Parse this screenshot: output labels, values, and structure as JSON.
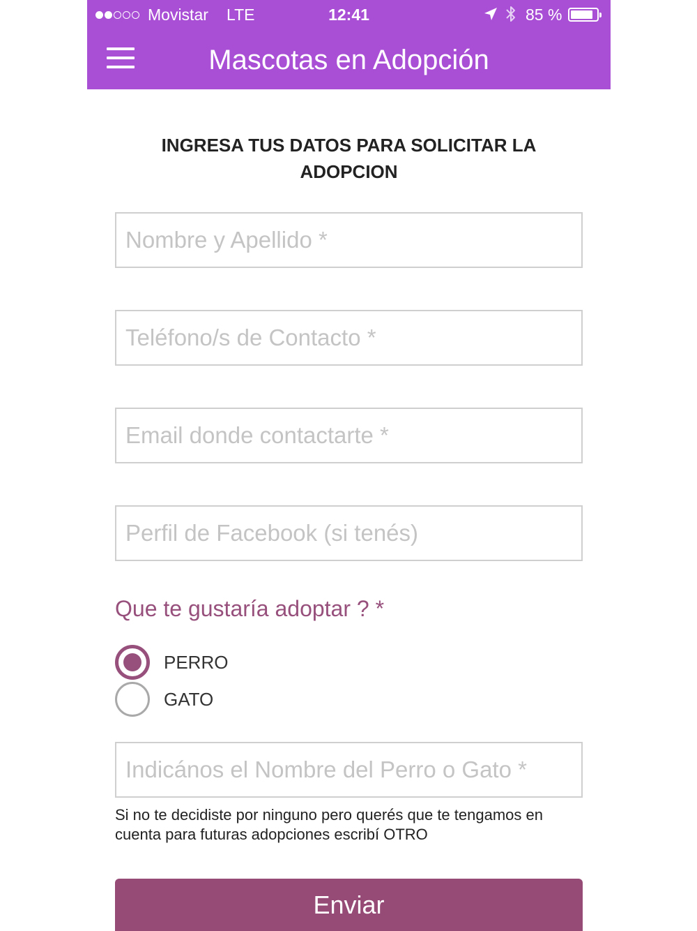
{
  "status_bar": {
    "carrier": "Movistar",
    "network": "LTE",
    "time": "12:41",
    "battery_percent": "85 %",
    "battery_level": 0.85,
    "signal_bars": 2,
    "signal_total": 5
  },
  "header": {
    "title": "Mascotas en Adopción",
    "menu_icon": "hamburger-menu-icon",
    "background_color": "#a94fd6"
  },
  "form": {
    "heading": "INGRESA TUS DATOS PARA SOLICITAR LA ADOPCION",
    "fields": [
      {
        "placeholder": "Nombre y Apellido *",
        "value": ""
      },
      {
        "placeholder": "Teléfono/s de Contacto *",
        "value": ""
      },
      {
        "placeholder": "Email donde contactarte *",
        "value": ""
      },
      {
        "placeholder": "Perfil de Facebook (si tenés)",
        "value": ""
      }
    ],
    "question": "Que te gustaría adoptar ? *",
    "options": [
      {
        "label": "PERRO",
        "selected": true
      },
      {
        "label": "GATO",
        "selected": false
      }
    ],
    "pet_name_field": {
      "placeholder": "Indicános el Nombre del Perro o Gato *",
      "value": ""
    },
    "hint": "Si no te decidiste por ninguno pero querés que te tengamos en cuenta para futuras adopciones escribí OTRO",
    "submit_label": "Enviar",
    "accent_color": "#97507c"
  }
}
